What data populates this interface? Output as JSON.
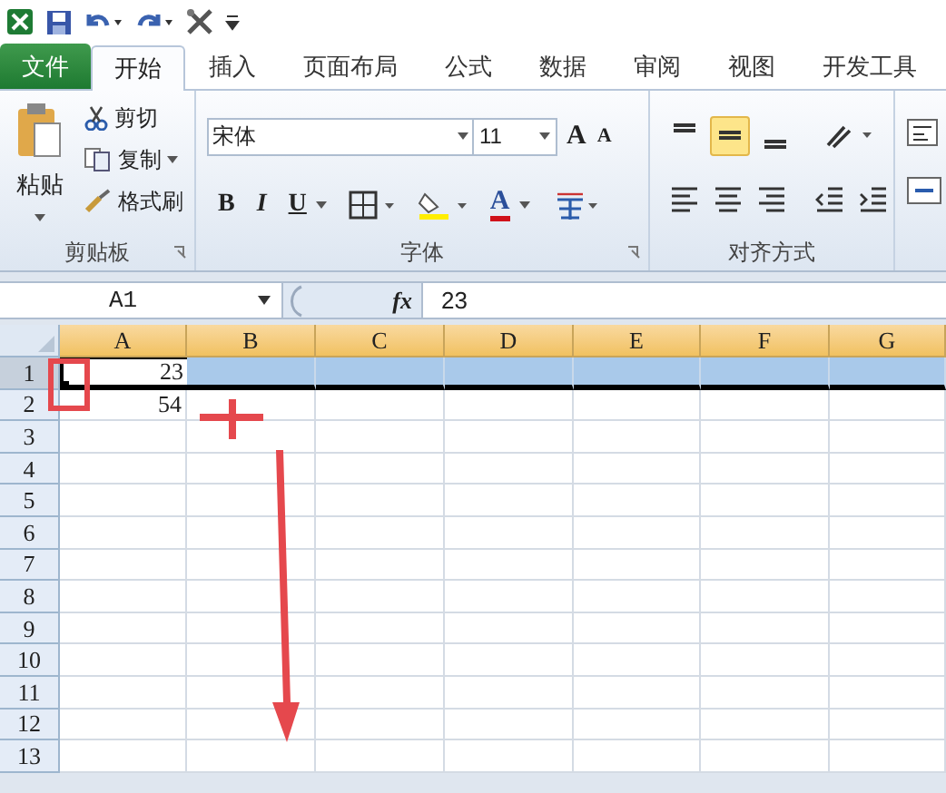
{
  "tabs": [
    {
      "label": "文件",
      "kind": "file",
      "selected": false
    },
    {
      "label": "开始",
      "kind": "tab",
      "selected": true
    },
    {
      "label": "插入",
      "kind": "tab",
      "selected": false
    },
    {
      "label": "页面布局",
      "kind": "tab",
      "selected": false
    },
    {
      "label": "公式",
      "kind": "tab",
      "selected": false
    },
    {
      "label": "数据",
      "kind": "tab",
      "selected": false
    },
    {
      "label": "审阅",
      "kind": "tab",
      "selected": false
    },
    {
      "label": "视图",
      "kind": "tab",
      "selected": false
    },
    {
      "label": "开发工具",
      "kind": "tab",
      "selected": false
    }
  ],
  "clipboard": {
    "paste": "粘贴",
    "cut": "剪切",
    "copy": "复制",
    "format_painter": "格式刷",
    "title": "剪贴板"
  },
  "font": {
    "name": "宋体",
    "size": "11",
    "grow": "A",
    "shrink": "A",
    "bold": "B",
    "italic": "I",
    "underline": "U",
    "font_color": "A",
    "title": "字体"
  },
  "alignment": {
    "title": "对齐方式",
    "buttons": [
      {
        "kind": "top",
        "selected": false
      },
      {
        "kind": "middle",
        "selected": true
      },
      {
        "kind": "bottom",
        "selected": false
      }
    ]
  },
  "formula_bar": {
    "name_box": "A1",
    "fx": "fx",
    "value": "23"
  },
  "sheet": {
    "columns": [
      {
        "label": "A",
        "selected": true
      },
      {
        "label": "B",
        "selected": true
      },
      {
        "label": "C",
        "selected": true
      },
      {
        "label": "D",
        "selected": true
      },
      {
        "label": "E",
        "selected": true
      },
      {
        "label": "F",
        "selected": true
      },
      {
        "label": "G",
        "selected": true
      }
    ],
    "rows": [
      {
        "label": "1",
        "selected": true,
        "cells": [
          "23"
        ]
      },
      {
        "label": "2",
        "selected": false,
        "cells": [
          "54"
        ]
      },
      {
        "label": "3",
        "selected": false,
        "cells": []
      },
      {
        "label": "4",
        "selected": false,
        "cells": []
      },
      {
        "label": "5",
        "selected": false,
        "cells": []
      },
      {
        "label": "6",
        "selected": false,
        "cells": []
      },
      {
        "label": "7",
        "selected": false,
        "cells": []
      },
      {
        "label": "8",
        "selected": false,
        "cells": []
      },
      {
        "label": "9",
        "selected": false,
        "cells": []
      },
      {
        "label": "10",
        "selected": false,
        "cells": []
      },
      {
        "label": "11",
        "selected": false,
        "cells": []
      },
      {
        "label": "12",
        "selected": false,
        "cells": []
      },
      {
        "label": "13",
        "selected": false,
        "cells": []
      }
    ]
  }
}
